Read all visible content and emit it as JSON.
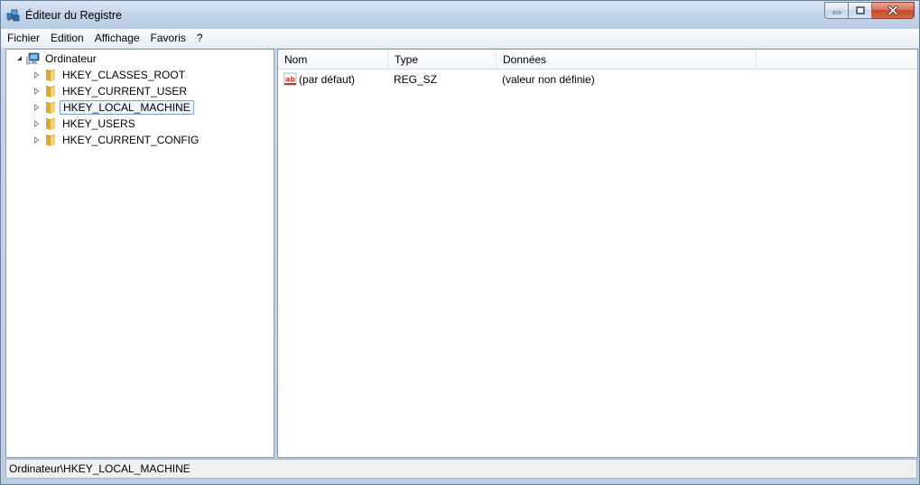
{
  "window": {
    "title": "Éditeur du Registre"
  },
  "menu": {
    "items": [
      "Fichier",
      "Edition",
      "Affichage",
      "Favoris",
      "?"
    ]
  },
  "tree": {
    "root": "Ordinateur",
    "children": [
      {
        "label": "HKEY_CLASSES_ROOT",
        "selected": false
      },
      {
        "label": "HKEY_CURRENT_USER",
        "selected": false
      },
      {
        "label": "HKEY_LOCAL_MACHINE",
        "selected": true
      },
      {
        "label": "HKEY_USERS",
        "selected": false
      },
      {
        "label": "HKEY_CURRENT_CONFIG",
        "selected": false
      }
    ]
  },
  "list": {
    "columns": [
      "Nom",
      "Type",
      "Données"
    ],
    "rows": [
      {
        "name": "(par défaut)",
        "type": "REG_SZ",
        "data": "(valeur non définie)",
        "icon": "string-value-icon"
      }
    ]
  },
  "status": {
    "path": "Ordinateur\\HKEY_LOCAL_MACHINE"
  },
  "colors": {
    "selection_border": "#7da2ce",
    "folder": "#e9c25c",
    "close_button": "#c5452a"
  }
}
